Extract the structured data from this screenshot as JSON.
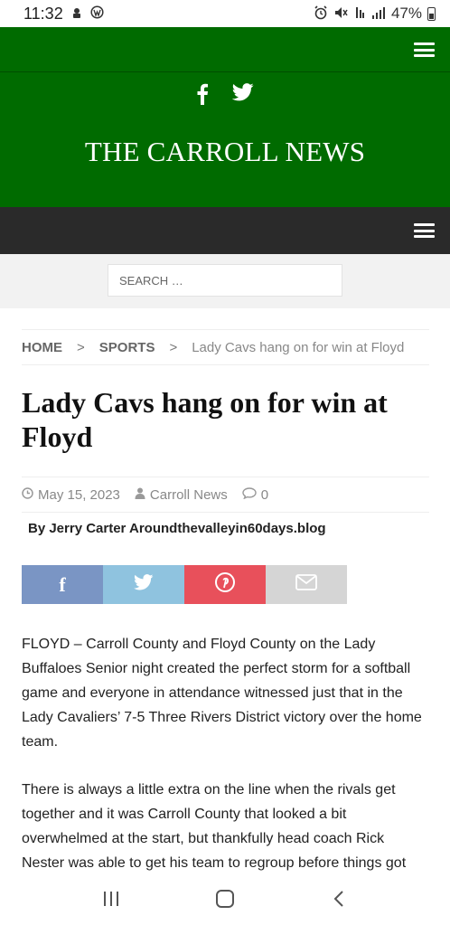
{
  "status_bar": {
    "time": "11:32",
    "battery": "47%"
  },
  "header": {
    "site_title": "THE CARROLL NEWS",
    "social": [
      "f",
      "twitter-bird"
    ],
    "colors": {
      "brand_green": "#006b00",
      "nav_dark": "#2a2a2a"
    }
  },
  "search": {
    "placeholder": "SEARCH …"
  },
  "breadcrumb": {
    "home": "HOME",
    "sports": "SPORTS",
    "current": "Lady Cavs hang on for win at Floyd",
    "separator": ">"
  },
  "article": {
    "title": "Lady Cavs hang on for win at Floyd",
    "date": "May 15, 2023",
    "author": "Carroll News",
    "comments": "0",
    "byline": "By Jerry Carter Aroundthevalleyin60days.blog",
    "paragraphs": [
      "FLOYD – Carroll County and Floyd County on the Lady Buffaloes Senior night created the perfect storm for a softball game and everyone in attendance witnessed just that in the Lady Cavaliers’ 7-5 Three Rivers District victory over the home team.",
      "There is always a little extra on the line when the rivals get together and it was Carroll County that looked a bit overwhelmed at the start, but thankfully head coach Rick Nester was able to get his team to regroup before things got"
    ]
  },
  "share": {
    "facebook": "f",
    "colors": {
      "facebook": "#7a95c4",
      "twitter": "#8fc3df",
      "pinterest": "#e8505b",
      "email": "#d5d5d5"
    }
  }
}
